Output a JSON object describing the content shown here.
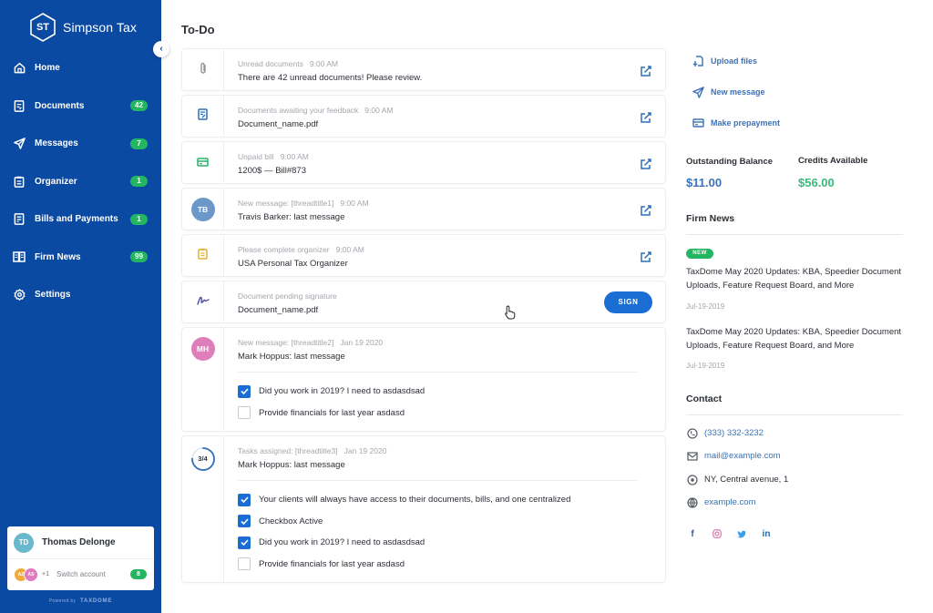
{
  "brand": {
    "logo_initials": "ST",
    "name": "Simpson Tax"
  },
  "sidebar": {
    "collapse_icon": "chevron-left-icon",
    "items": [
      {
        "label": "Home",
        "icon": "home-icon",
        "badge": null
      },
      {
        "label": "Documents",
        "icon": "document-icon",
        "badge": "42"
      },
      {
        "label": "Messages",
        "icon": "paper-plane-icon",
        "badge": "7"
      },
      {
        "label": "Organizer",
        "icon": "clipboard-icon",
        "badge": "1"
      },
      {
        "label": "Bills and Payments",
        "icon": "bill-icon",
        "badge": "1"
      },
      {
        "label": "Firm News",
        "icon": "newspaper-icon",
        "badge": "99"
      },
      {
        "label": "Settings",
        "icon": "gear-icon",
        "badge": null
      }
    ],
    "account": {
      "initials": "TD",
      "name": "Thomas Delonge",
      "other_accounts": [
        "AZ",
        "AS"
      ],
      "more_count": "+1",
      "switch_label": "Switch account",
      "switch_badge": "8"
    },
    "powered_by": {
      "prefix": "Powered by",
      "brand": "TAXDOME"
    }
  },
  "main": {
    "title": "To-Do",
    "todos": [
      {
        "type": "unread",
        "icon": "paperclip-icon",
        "label": "Unread documents",
        "time": "9:00 AM",
        "title": "There are 42 unread documents!  Please review.",
        "action": "edit"
      },
      {
        "type": "feedback",
        "icon": "document-edit-icon",
        "label": "Documents awaiting your feedback",
        "time": "9:00 AM",
        "title": "Document_name.pdf",
        "action": "edit"
      },
      {
        "type": "bill",
        "icon": "credit-card-icon",
        "label": "Unpaid bill",
        "time": "9:00 AM",
        "title": "1200$ — Bill#873",
        "action": "edit"
      },
      {
        "type": "message",
        "avatar": "TB",
        "avatar_color": "#6b98c9",
        "label": "New message: [threadtitle1]",
        "time": "9:00 AM",
        "title": "Travis Barker: last message",
        "action": "edit"
      },
      {
        "type": "organizer",
        "icon": "organizer-icon",
        "label": "Please complete organizer",
        "time": "9:00 AM",
        "title": "USA Personal Tax Organizer",
        "action": "edit"
      },
      {
        "type": "signature",
        "icon": "signature-icon",
        "label": "Document pending signature",
        "time": "",
        "title": "Document_name.pdf",
        "action": "sign",
        "action_label": "SIGN"
      }
    ],
    "message_card": {
      "avatar": "MH",
      "avatar_color": "#de7fbb",
      "label": "New message: [threadtitle2]",
      "time": "Jan 19 2020",
      "title": "Mark Hoppus: last message",
      "checklist": [
        {
          "text": "Did you work in 2019? I need to asdasdsad",
          "checked": true
        },
        {
          "text": "Provide financials for last year asdasd",
          "checked": false
        }
      ]
    },
    "tasks_card": {
      "progress_label": "3/4",
      "progress_fraction": 0.75,
      "label": "Tasks assigned: [threadtitle3]",
      "time": "Jan 19 2020",
      "title": "Mark Hoppus: last message",
      "checklist": [
        {
          "text": "Your clients will always have access to their documents, bills, and one centralized",
          "checked": true
        },
        {
          "text": "Checkbox Active",
          "checked": true
        },
        {
          "text": "Did you work in 2019? I need to asdasdsad",
          "checked": true
        },
        {
          "text": "Provide financials for last year asdasd",
          "checked": false
        }
      ]
    }
  },
  "right": {
    "actions": [
      {
        "label": "Upload files",
        "icon": "upload-file-icon"
      },
      {
        "label": "New message",
        "icon": "paper-plane-icon"
      },
      {
        "label": "Make prepayment",
        "icon": "credit-card-icon"
      }
    ],
    "balance": {
      "outstanding_label": "Outstanding Balance",
      "outstanding_value": "$11.00",
      "credits_label": "Credits Available",
      "credits_value": "$56.00"
    },
    "firm_news": {
      "title": "Firm News",
      "new_badge": "NEW",
      "items": [
        {
          "title": "TaxDome May 2020 Updates: KBA, Speedier Document Uploads, Feature Request Board, and More",
          "date": "Jul-19-2019"
        },
        {
          "title": "TaxDome May 2020 Updates: KBA, Speedier Document Uploads, Feature Request Board, and More",
          "date": "Jul-19-2019"
        }
      ]
    },
    "contact": {
      "title": "Contact",
      "phone": "(333) 332-3232",
      "email": "mail@example.com",
      "address": "NY, Central avenue, 1",
      "website": "example.com",
      "socials": [
        "facebook-icon",
        "instagram-icon",
        "twitter-icon",
        "linkedin-icon"
      ]
    }
  },
  "colors": {
    "sidebar_bg": "#0b4aa2",
    "accent": "#1a6ed3",
    "link": "#3c72b7",
    "badge_green": "#24b561",
    "credits_green": "#3cb97a"
  }
}
